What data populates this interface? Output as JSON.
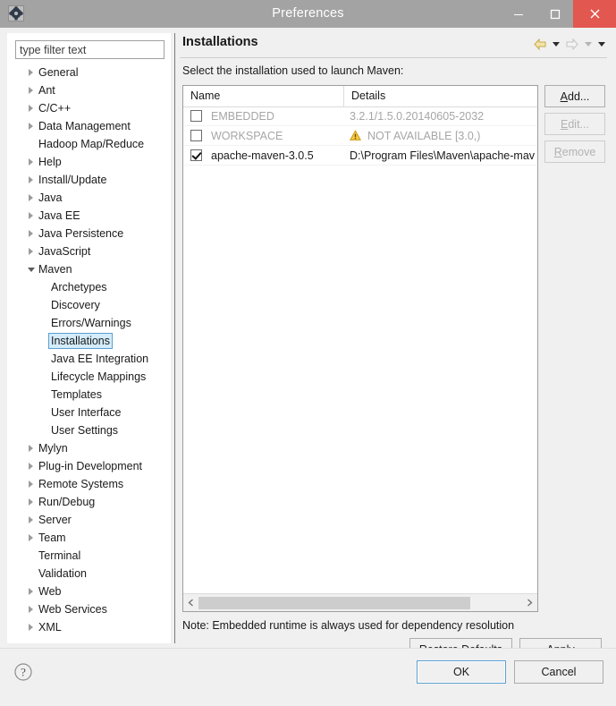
{
  "window": {
    "title": "Preferences",
    "icon": "gear-icon",
    "controls": {
      "minimize": "minimize-icon",
      "maximize": "maximize-icon",
      "close": "close-icon"
    },
    "close_color": "#e2574f",
    "titlebar_color": "#a3a3a3"
  },
  "sidebar": {
    "filter": {
      "value": "",
      "placeholder": "type filter text"
    },
    "items": [
      {
        "label": "General",
        "level": 1,
        "expandable": true,
        "expanded": false,
        "selected": false
      },
      {
        "label": "Ant",
        "level": 1,
        "expandable": true,
        "expanded": false,
        "selected": false
      },
      {
        "label": "C/C++",
        "level": 1,
        "expandable": true,
        "expanded": false,
        "selected": false
      },
      {
        "label": "Data Management",
        "level": 1,
        "expandable": true,
        "expanded": false,
        "selected": false
      },
      {
        "label": "Hadoop Map/Reduce",
        "level": 1,
        "expandable": false,
        "expanded": false,
        "selected": false
      },
      {
        "label": "Help",
        "level": 1,
        "expandable": true,
        "expanded": false,
        "selected": false
      },
      {
        "label": "Install/Update",
        "level": 1,
        "expandable": true,
        "expanded": false,
        "selected": false
      },
      {
        "label": "Java",
        "level": 1,
        "expandable": true,
        "expanded": false,
        "selected": false
      },
      {
        "label": "Java EE",
        "level": 1,
        "expandable": true,
        "expanded": false,
        "selected": false
      },
      {
        "label": "Java Persistence",
        "level": 1,
        "expandable": true,
        "expanded": false,
        "selected": false
      },
      {
        "label": "JavaScript",
        "level": 1,
        "expandable": true,
        "expanded": false,
        "selected": false
      },
      {
        "label": "Maven",
        "level": 1,
        "expandable": true,
        "expanded": true,
        "selected": false
      },
      {
        "label": "Archetypes",
        "level": 2,
        "expandable": false,
        "expanded": false,
        "selected": false
      },
      {
        "label": "Discovery",
        "level": 2,
        "expandable": false,
        "expanded": false,
        "selected": false
      },
      {
        "label": "Errors/Warnings",
        "level": 2,
        "expandable": false,
        "expanded": false,
        "selected": false
      },
      {
        "label": "Installations",
        "level": 2,
        "expandable": false,
        "expanded": false,
        "selected": true
      },
      {
        "label": "Java EE Integration",
        "level": 2,
        "expandable": false,
        "expanded": false,
        "selected": false
      },
      {
        "label": "Lifecycle Mappings",
        "level": 2,
        "expandable": false,
        "expanded": false,
        "selected": false
      },
      {
        "label": "Templates",
        "level": 2,
        "expandable": false,
        "expanded": false,
        "selected": false
      },
      {
        "label": "User Interface",
        "level": 2,
        "expandable": false,
        "expanded": false,
        "selected": false
      },
      {
        "label": "User Settings",
        "level": 2,
        "expandable": false,
        "expanded": false,
        "selected": false
      },
      {
        "label": "Mylyn",
        "level": 1,
        "expandable": true,
        "expanded": false,
        "selected": false
      },
      {
        "label": "Plug-in Development",
        "level": 1,
        "expandable": true,
        "expanded": false,
        "selected": false
      },
      {
        "label": "Remote Systems",
        "level": 1,
        "expandable": true,
        "expanded": false,
        "selected": false
      },
      {
        "label": "Run/Debug",
        "level": 1,
        "expandable": true,
        "expanded": false,
        "selected": false
      },
      {
        "label": "Server",
        "level": 1,
        "expandable": true,
        "expanded": false,
        "selected": false
      },
      {
        "label": "Team",
        "level": 1,
        "expandable": true,
        "expanded": false,
        "selected": false
      },
      {
        "label": "Terminal",
        "level": 1,
        "expandable": false,
        "expanded": false,
        "selected": false
      },
      {
        "label": "Validation",
        "level": 1,
        "expandable": false,
        "expanded": false,
        "selected": false
      },
      {
        "label": "Web",
        "level": 1,
        "expandable": true,
        "expanded": false,
        "selected": false
      },
      {
        "label": "Web Services",
        "level": 1,
        "expandable": true,
        "expanded": false,
        "selected": false
      },
      {
        "label": "XML",
        "level": 1,
        "expandable": true,
        "expanded": false,
        "selected": false
      }
    ],
    "selection_bg": "#d4ecfb",
    "selection_border": "#5c9fd0"
  },
  "page": {
    "title": "Installations",
    "instruction": "Select the installation used to launch Maven:",
    "note": "Note: Embedded runtime is always used for dependency resolution",
    "nav": {
      "back_icon": "back-arrow-icon",
      "back_dropdown_icon": "chevron-down-icon",
      "forward_icon": "forward-arrow-icon",
      "forward_dropdown_icon": "chevron-down-icon",
      "menu_icon": "chevron-down-icon",
      "back_color": "#e8d48a",
      "forward_color": "#cfcfcf"
    }
  },
  "table": {
    "columns": [
      "Name",
      "Details"
    ],
    "rows": [
      {
        "checked": false,
        "name": "EMBEDDED",
        "details": "3.2.1/1.5.0.20140605-2032",
        "muted": true,
        "warning": false
      },
      {
        "checked": false,
        "name": "WORKSPACE",
        "details": "NOT AVAILABLE [3.0,)",
        "muted": true,
        "warning": true,
        "warning_icon": "warning-triangle-icon"
      },
      {
        "checked": true,
        "name": "apache-maven-3.0.5",
        "details": "D:\\Program Files\\Maven\\apache-mav",
        "muted": false,
        "warning": false
      }
    ],
    "scrollbar": {
      "left_arrow": "chevron-left-icon",
      "right_arrow": "chevron-right-icon"
    }
  },
  "side_buttons": [
    {
      "label": "Add...",
      "mnemonic": "A",
      "enabled": true
    },
    {
      "label": "Edit...",
      "mnemonic": "E",
      "enabled": false
    },
    {
      "label": "Remove",
      "mnemonic": "R",
      "enabled": false
    }
  ],
  "page_buttons": {
    "restore_defaults": "Restore Defaults",
    "restore_defaults_mnemonic": "D",
    "apply": "Apply",
    "apply_mnemonic": "A"
  },
  "footer": {
    "help_icon": "help-question-icon",
    "ok": "OK",
    "cancel": "Cancel",
    "default_button": "OK"
  }
}
